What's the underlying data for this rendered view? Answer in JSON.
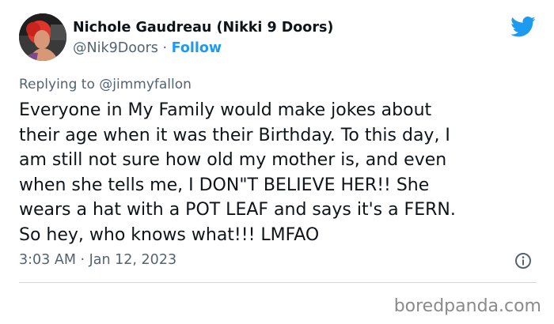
{
  "tweet": {
    "author": {
      "display_name": "Nichole Gaudreau (Nikki 9 Doors)",
      "handle": "@Nik9Doors",
      "separator": " · ",
      "follow_label": "Follow"
    },
    "reply": {
      "prefix": "Replying to ",
      "to_handle": "@jimmyfallon"
    },
    "body_lines": [
      "Everyone in My Family would make jokes about",
      "their age when it was their Birthday. To this day, I",
      "am still not sure how old my mother is, and even",
      "when she tells me, I DON\"T BELIEVE HER!! She",
      "wears a hat with a POT LEAF and says it's a FERN.",
      "So hey, who knows what!!! LMFAO"
    ],
    "timestamp": "3:03 AM · Jan 12, 2023",
    "icons": {
      "brand": "twitter-bird-icon",
      "info": "info-icon"
    }
  },
  "watermark": "boredpanda.com",
  "colors": {
    "accent": "#1d9bf0",
    "text_primary": "#0f1419",
    "text_secondary": "#536471",
    "divider": "#cfd9de",
    "watermark": "#8a8a8a"
  }
}
